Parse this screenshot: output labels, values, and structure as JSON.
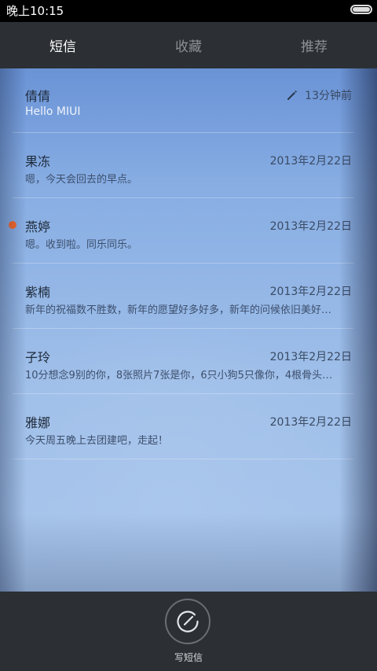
{
  "status_bar": {
    "time": "晚上10:15",
    "battery_level": 1.0
  },
  "tabs": [
    {
      "label": "短信",
      "active": true
    },
    {
      "label": "收藏",
      "active": false
    },
    {
      "label": "推荐",
      "active": false
    }
  ],
  "conversations": [
    {
      "name": "倩倩",
      "date": "13分钟前",
      "preview": "Hello MIUI",
      "draft": true,
      "unread": false
    },
    {
      "name": "果冻",
      "date": "2013年2月22日",
      "preview": "嗯，今天会回去的早点。",
      "draft": false,
      "unread": false
    },
    {
      "name": "燕婷",
      "date": "2013年2月22日",
      "preview": "嗯。收到啦。同乐同乐。",
      "draft": false,
      "unread": true
    },
    {
      "name": "紫楠",
      "date": "2013年2月22日",
      "preview": "新年的祝福数不胜数，新年的愿望好多好多，新年的问候依旧美好…",
      "draft": false,
      "unread": false
    },
    {
      "name": "子玲",
      "date": "2013年2月22日",
      "preview": "10分想念9别的你，8张照片7张是你，6只小狗5只像你，4根骨头…",
      "draft": false,
      "unread": false
    },
    {
      "name": "雅娜",
      "date": "2013年2月22日",
      "preview": "今天周五晚上去团建吧，走起！",
      "draft": false,
      "unread": false
    }
  ],
  "bottom_bar": {
    "compose_label": "写短信"
  },
  "colors": {
    "unread_dot": "#ff6a27",
    "bar_background": "#2c2f33",
    "tab_active": "#ffffff",
    "tab_inactive": "#8d9096"
  }
}
